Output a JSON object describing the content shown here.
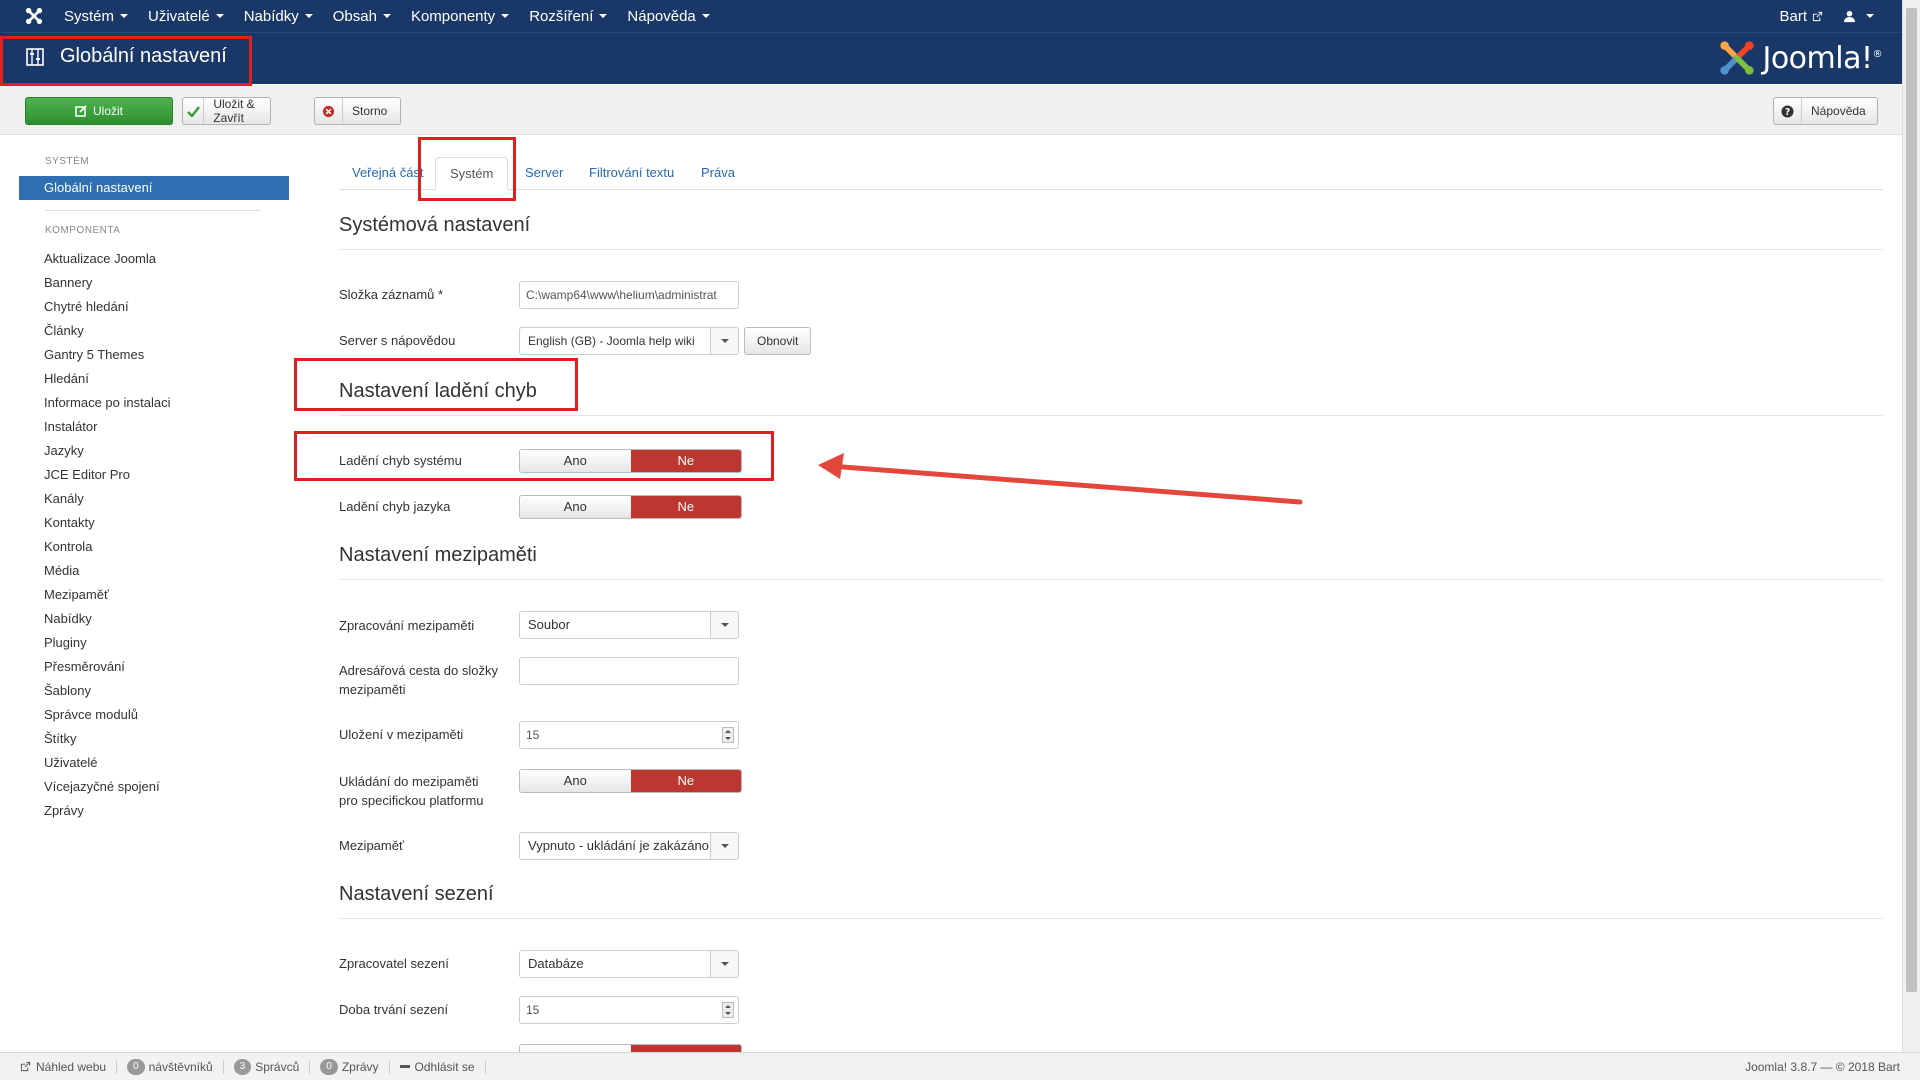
{
  "navbar": {
    "menu": [
      "Systém",
      "Uživatelé",
      "Nabídky",
      "Obsah",
      "Komponenty",
      "Rozšíření",
      "Nápověda"
    ],
    "user": "Bart"
  },
  "header": {
    "title": "Globální nastavení",
    "brand": "Joomla!"
  },
  "toolbar": {
    "save": "Uložit",
    "save_close": "Uložit & Zavřít",
    "cancel": "Storno",
    "help": "Nápověda"
  },
  "sidebar": {
    "system_head": "SYSTÉM",
    "active": "Globální nastavení",
    "component_head": "KOMPONENTA",
    "items": [
      "Aktualizace Joomla",
      "Bannery",
      "Chytré hledání",
      "Články",
      "Gantry 5 Themes",
      "Hledání",
      "Informace po instalaci",
      "Instalátor",
      "Jazyky",
      "JCE Editor Pro",
      "Kanály",
      "Kontakty",
      "Kontrola",
      "Média",
      "Mezipaměť",
      "Nabídky",
      "Pluginy",
      "Přesměrování",
      "Šablony",
      "Správce modulů",
      "Štítky",
      "Uživatelé",
      "Vícejazyčné spojení",
      "Zprávy"
    ]
  },
  "tabs": [
    "Veřejná část",
    "Systém",
    "Server",
    "Filtrování textu",
    "Práva"
  ],
  "sections": {
    "system": "Systémová nastavení",
    "debug": "Nastavení ladění chyb",
    "cache": "Nastavení mezipaměti",
    "session": "Nastavení sezení"
  },
  "fields": {
    "log_folder_label": "Složka záznamů *",
    "log_folder_value": "C:\\wamp64\\www\\helium\\administrat",
    "help_server_label": "Server s nápovědou",
    "help_server_value": "English (GB) - Joomla help wiki",
    "refresh": "Obnovit",
    "debug_system_label": "Ladění chyb systému",
    "debug_lang_label": "Ladění chyb jazyka",
    "yes": "Ano",
    "no": "Ne",
    "cache_handler_label": "Zpracování mezipaměti",
    "cache_handler_value": "Soubor",
    "cache_path_label_1": "Adresářová cesta do složky",
    "cache_path_label_2": "mezipaměti",
    "cache_time_label": "Uložení v mezipaměti",
    "cache_time_value": "15",
    "platform_cache_label_1": "Ukládání do mezipaměti",
    "platform_cache_label_2": "pro specifickou platformu",
    "cache_label": "Mezipaměť",
    "cache_value": "Vypnuto - ukládání je zakázáno",
    "session_handler_label": "Zpracovatel sezení",
    "session_handler_value": "Databáze",
    "session_lifetime_label": "Doba trvání sezení",
    "session_lifetime_value": "15"
  },
  "statusbar": {
    "preview": "Náhled webu",
    "visitors_count": "0",
    "visitors": "návštěvníků",
    "admins_count": "3",
    "admins": "Správců",
    "messages_count": "0",
    "messages": "Zprávy",
    "logout": "Odhlásit se",
    "version": "Joomla! 3.8.7 — © 2018 Bart"
  },
  "colors": {
    "navbar": "#1a3867",
    "save_button": "#3d9f3d",
    "toggle_no": "#bd362f",
    "annotation": "#e0201f"
  }
}
